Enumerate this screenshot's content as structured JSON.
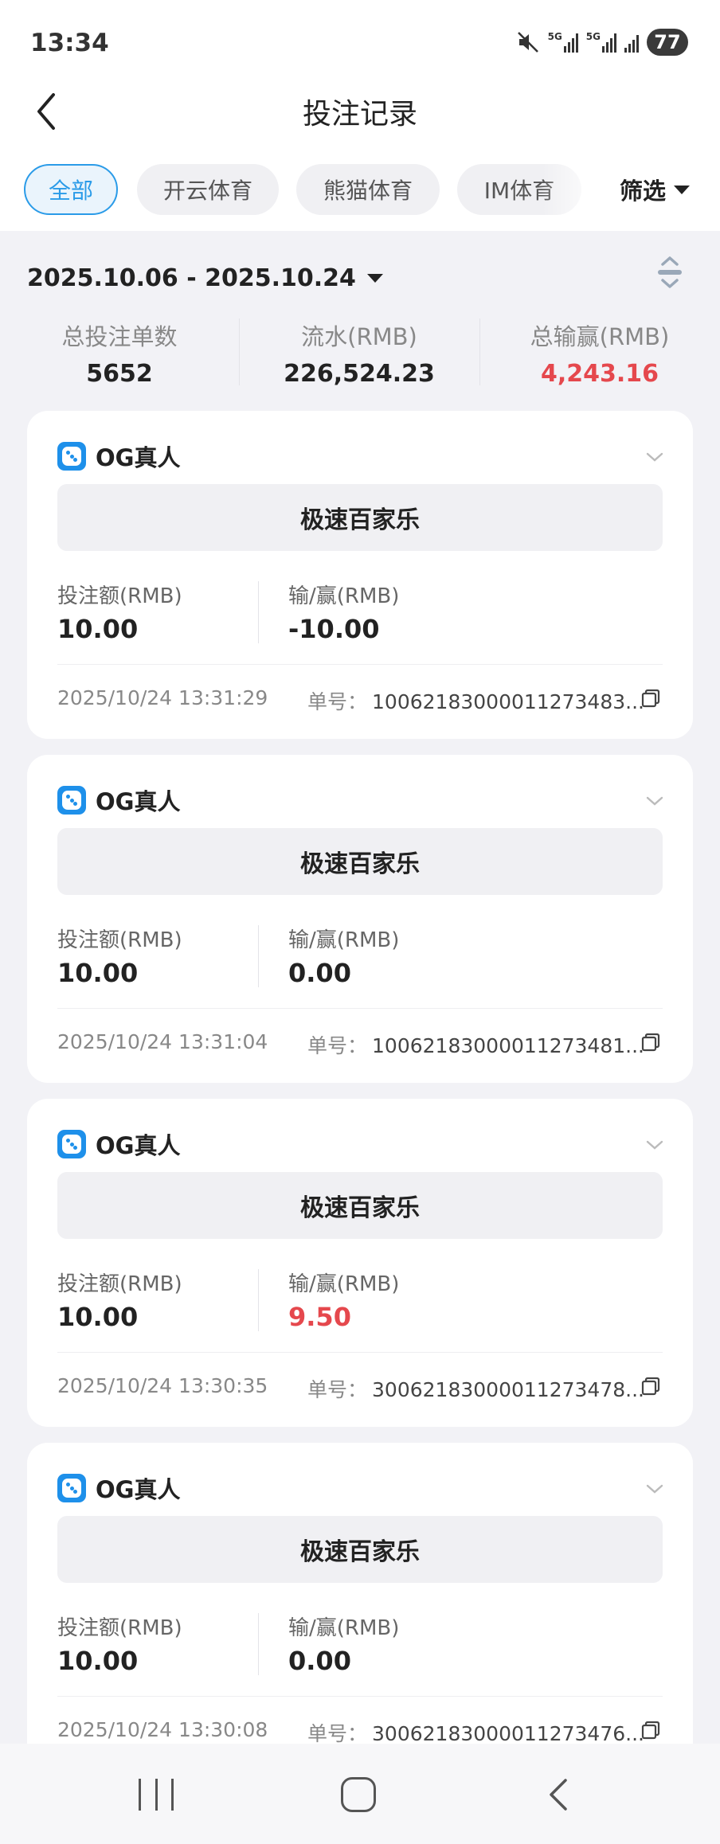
{
  "status": {
    "time": "13:34",
    "battery": "77",
    "signal_label": "5G"
  },
  "header": {
    "title": "投注记录"
  },
  "tabs": [
    {
      "label": "全部",
      "active": true
    },
    {
      "label": "开云体育",
      "active": false
    },
    {
      "label": "熊猫体育",
      "active": false
    },
    {
      "label": "IM体育",
      "active": false
    }
  ],
  "filter": {
    "label": "筛选"
  },
  "date_range": "2025.10.06 - 2025.10.24",
  "summary": [
    {
      "label": "总投注单数",
      "value": "5652"
    },
    {
      "label": "流水(RMB)",
      "value": "226,524.23"
    },
    {
      "label": "总输赢(RMB)",
      "value": "4,243.16"
    }
  ],
  "labels": {
    "stake": "投注额(RMB)",
    "winloss": "输/赢(RMB)",
    "order_no": "单号："
  },
  "bets": [
    {
      "provider": "OG真人",
      "game": "极速百家乐",
      "stake": "10.00",
      "winloss": "-10.00",
      "time": "2025/10/24 13:31:29",
      "order": "10062183000011273483..."
    },
    {
      "provider": "OG真人",
      "game": "极速百家乐",
      "stake": "10.00",
      "winloss": "0.00",
      "time": "2025/10/24 13:31:04",
      "order": "10062183000011273481..."
    },
    {
      "provider": "OG真人",
      "game": "极速百家乐",
      "stake": "10.00",
      "winloss": "9.50",
      "time": "2025/10/24 13:30:35",
      "order": "30062183000011273478..."
    },
    {
      "provider": "OG真人",
      "game": "极速百家乐",
      "stake": "10.00",
      "winloss": "0.00",
      "time": "2025/10/24 13:30:08",
      "order": "30062183000011273476..."
    }
  ],
  "colors": {
    "accent": "#2a9be8",
    "win": "#e5484d",
    "background": "#f2f2f6"
  }
}
